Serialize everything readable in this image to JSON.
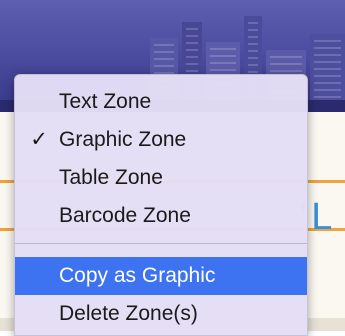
{
  "context_menu": {
    "items": [
      {
        "label": "Text Zone",
        "checked": false
      },
      {
        "label": "Graphic Zone",
        "checked": true,
        "check_glyph": "✓"
      },
      {
        "label": "Table Zone",
        "checked": false
      },
      {
        "label": "Barcode Zone",
        "checked": false
      },
      {
        "label": "Copy as Graphic",
        "highlighted": true
      },
      {
        "label": "Delete Zone(s)",
        "highlighted": false
      }
    ]
  },
  "background": {
    "partial_text": "'L"
  },
  "colors": {
    "highlight": "#3d72f0",
    "menu_bg": "#e4def6",
    "accent_orange": "#f0a23c",
    "accent_blue": "#3a8fd6"
  }
}
